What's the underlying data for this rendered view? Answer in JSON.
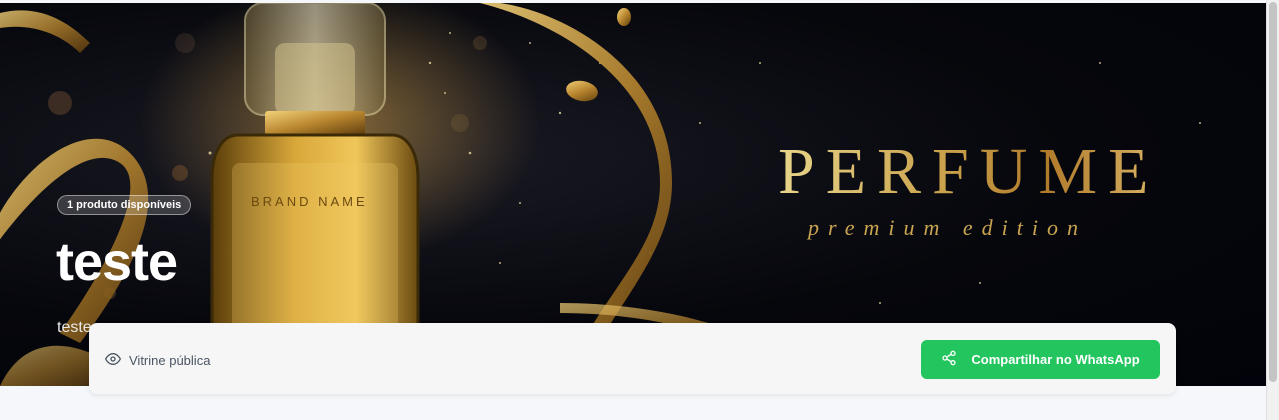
{
  "hero": {
    "badge": "1 produto disponíveis",
    "title": "teste",
    "subtitle": "teste",
    "banner_word": "PERFUME",
    "banner_tagline": "premium edition",
    "bottle_label": "BRAND NAME"
  },
  "panel": {
    "visibility_label": "Vitrine pública",
    "share_button_label": "Compartilhar no WhatsApp"
  },
  "icons": {
    "visibility": "eye-icon",
    "share": "share-icon"
  },
  "colors": {
    "accent_green": "#22c55e",
    "gold": "#c9a04a"
  }
}
